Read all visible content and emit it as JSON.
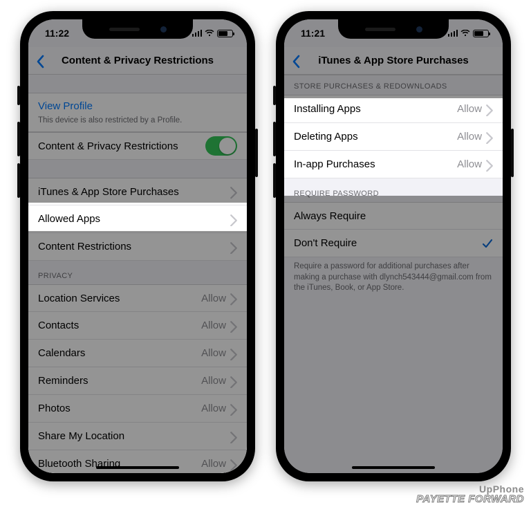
{
  "phone1": {
    "status_time": "11:22",
    "nav_title": "Content & Privacy Restrictions",
    "view_profile": "View Profile",
    "profile_note": "This device is also restricted by a Profile.",
    "toggle_label": "Content & Privacy Restrictions",
    "rows": {
      "itunes": "iTunes & App Store Purchases",
      "allowed": "Allowed Apps",
      "content": "Content Restrictions"
    },
    "privacy_header": "PRIVACY",
    "privacy_rows": [
      {
        "label": "Location Services",
        "val": "Allow"
      },
      {
        "label": "Contacts",
        "val": "Allow"
      },
      {
        "label": "Calendars",
        "val": "Allow"
      },
      {
        "label": "Reminders",
        "val": "Allow"
      },
      {
        "label": "Photos",
        "val": "Allow"
      },
      {
        "label": "Share My Location",
        "val": ""
      },
      {
        "label": "Bluetooth Sharing",
        "val": "Allow"
      }
    ]
  },
  "phone2": {
    "status_time": "11:21",
    "nav_title": "iTunes & App Store Purchases",
    "store_header": "STORE PURCHASES & REDOWNLOADS",
    "store_rows": [
      {
        "label": "Installing Apps",
        "val": "Allow"
      },
      {
        "label": "Deleting Apps",
        "val": "Allow"
      },
      {
        "label": "In-app Purchases",
        "val": "Allow"
      }
    ],
    "require_header": "REQUIRE PASSWORD",
    "require_rows": {
      "always": "Always Require",
      "dont": "Don't Require"
    },
    "footer": "Require a password for additional purchases after making a purchase with dlynch543444@gmail.com from the iTunes, Book, or App Store."
  },
  "watermark": {
    "line1": "UpPhone",
    "line2": "PAYETTE FORWARD"
  }
}
